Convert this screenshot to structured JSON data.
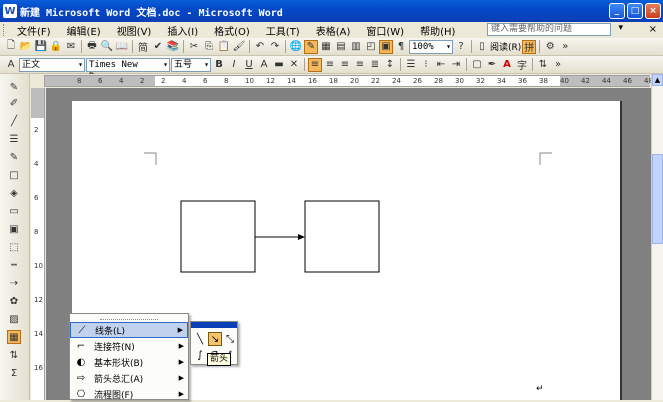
{
  "window": {
    "title": "新建 Microsoft Word 文档.doc - Microsoft Word",
    "app_icon": "W"
  },
  "window_buttons": [
    "_",
    "□",
    "×"
  ],
  "menu": [
    "文件(F)",
    "编辑(E)",
    "视图(V)",
    "插入(I)",
    "格式(O)",
    "工具(T)",
    "表格(A)",
    "窗口(W)",
    "帮助(H)"
  ],
  "help": {
    "placeholder": "键入需要帮助的问题",
    "close": "×"
  },
  "toolbar_standard": {
    "zoom": "100%",
    "read_label": "阅读(R)",
    "tradsimp": "简"
  },
  "toolbar_format": {
    "style": "正文",
    "font": "Times New Roman",
    "size": "五号",
    "bold": "B",
    "italic": "I",
    "underline": "U",
    "char_scale": "A",
    "font_color_a": "A"
  },
  "ruler_h": [
    "8",
    "6",
    "4",
    "2",
    "2",
    "4",
    "6",
    "8",
    "10",
    "12",
    "14",
    "16",
    "18",
    "20",
    "22",
    "24",
    "26",
    "28",
    "30",
    "32",
    "34",
    "36",
    "38",
    "40",
    "42",
    "44",
    "46",
    "48"
  ],
  "ruler_v": [
    "2",
    "4",
    "6",
    "8",
    "10",
    "12",
    "14",
    "16"
  ],
  "autoshape_menu": {
    "items": [
      {
        "label": "线条(L)"
      },
      {
        "label": "连接符(N)"
      },
      {
        "label": "基本形状(B)"
      },
      {
        "label": "箭头总汇(A)"
      },
      {
        "label": "流程图(F)"
      }
    ]
  },
  "lines_submenu": {
    "tooltip": "箭头"
  },
  "colors": {
    "title_bar": "#0348c7",
    "highlight": "#f5b85a",
    "menu_hot": "#c1d2ee"
  }
}
